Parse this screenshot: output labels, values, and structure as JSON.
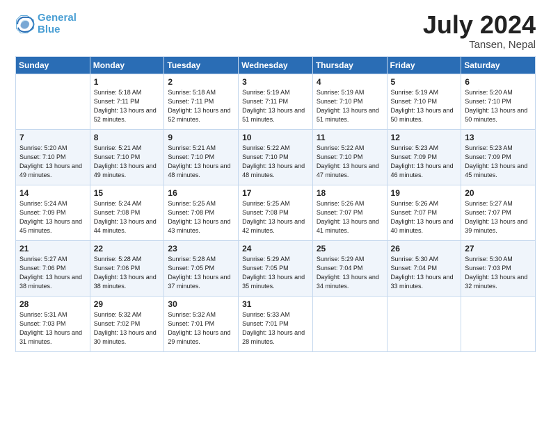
{
  "logo": {
    "line1": "General",
    "line2": "Blue"
  },
  "title": "July 2024",
  "location": "Tansen, Nepal",
  "weekdays": [
    "Sunday",
    "Monday",
    "Tuesday",
    "Wednesday",
    "Thursday",
    "Friday",
    "Saturday"
  ],
  "weeks": [
    [
      {
        "day": "",
        "info": ""
      },
      {
        "day": "1",
        "info": "Sunrise: 5:18 AM\nSunset: 7:11 PM\nDaylight: 13 hours\nand 52 minutes."
      },
      {
        "day": "2",
        "info": "Sunrise: 5:18 AM\nSunset: 7:11 PM\nDaylight: 13 hours\nand 52 minutes."
      },
      {
        "day": "3",
        "info": "Sunrise: 5:19 AM\nSunset: 7:11 PM\nDaylight: 13 hours\nand 51 minutes."
      },
      {
        "day": "4",
        "info": "Sunrise: 5:19 AM\nSunset: 7:10 PM\nDaylight: 13 hours\nand 51 minutes."
      },
      {
        "day": "5",
        "info": "Sunrise: 5:19 AM\nSunset: 7:10 PM\nDaylight: 13 hours\nand 50 minutes."
      },
      {
        "day": "6",
        "info": "Sunrise: 5:20 AM\nSunset: 7:10 PM\nDaylight: 13 hours\nand 50 minutes."
      }
    ],
    [
      {
        "day": "7",
        "info": "Sunrise: 5:20 AM\nSunset: 7:10 PM\nDaylight: 13 hours\nand 49 minutes."
      },
      {
        "day": "8",
        "info": "Sunrise: 5:21 AM\nSunset: 7:10 PM\nDaylight: 13 hours\nand 49 minutes."
      },
      {
        "day": "9",
        "info": "Sunrise: 5:21 AM\nSunset: 7:10 PM\nDaylight: 13 hours\nand 48 minutes."
      },
      {
        "day": "10",
        "info": "Sunrise: 5:22 AM\nSunset: 7:10 PM\nDaylight: 13 hours\nand 48 minutes."
      },
      {
        "day": "11",
        "info": "Sunrise: 5:22 AM\nSunset: 7:10 PM\nDaylight: 13 hours\nand 47 minutes."
      },
      {
        "day": "12",
        "info": "Sunrise: 5:23 AM\nSunset: 7:09 PM\nDaylight: 13 hours\nand 46 minutes."
      },
      {
        "day": "13",
        "info": "Sunrise: 5:23 AM\nSunset: 7:09 PM\nDaylight: 13 hours\nand 45 minutes."
      }
    ],
    [
      {
        "day": "14",
        "info": "Sunrise: 5:24 AM\nSunset: 7:09 PM\nDaylight: 13 hours\nand 45 minutes."
      },
      {
        "day": "15",
        "info": "Sunrise: 5:24 AM\nSunset: 7:08 PM\nDaylight: 13 hours\nand 44 minutes."
      },
      {
        "day": "16",
        "info": "Sunrise: 5:25 AM\nSunset: 7:08 PM\nDaylight: 13 hours\nand 43 minutes."
      },
      {
        "day": "17",
        "info": "Sunrise: 5:25 AM\nSunset: 7:08 PM\nDaylight: 13 hours\nand 42 minutes."
      },
      {
        "day": "18",
        "info": "Sunrise: 5:26 AM\nSunset: 7:07 PM\nDaylight: 13 hours\nand 41 minutes."
      },
      {
        "day": "19",
        "info": "Sunrise: 5:26 AM\nSunset: 7:07 PM\nDaylight: 13 hours\nand 40 minutes."
      },
      {
        "day": "20",
        "info": "Sunrise: 5:27 AM\nSunset: 7:07 PM\nDaylight: 13 hours\nand 39 minutes."
      }
    ],
    [
      {
        "day": "21",
        "info": "Sunrise: 5:27 AM\nSunset: 7:06 PM\nDaylight: 13 hours\nand 38 minutes."
      },
      {
        "day": "22",
        "info": "Sunrise: 5:28 AM\nSunset: 7:06 PM\nDaylight: 13 hours\nand 38 minutes."
      },
      {
        "day": "23",
        "info": "Sunrise: 5:28 AM\nSunset: 7:05 PM\nDaylight: 13 hours\nand 37 minutes."
      },
      {
        "day": "24",
        "info": "Sunrise: 5:29 AM\nSunset: 7:05 PM\nDaylight: 13 hours\nand 35 minutes."
      },
      {
        "day": "25",
        "info": "Sunrise: 5:29 AM\nSunset: 7:04 PM\nDaylight: 13 hours\nand 34 minutes."
      },
      {
        "day": "26",
        "info": "Sunrise: 5:30 AM\nSunset: 7:04 PM\nDaylight: 13 hours\nand 33 minutes."
      },
      {
        "day": "27",
        "info": "Sunrise: 5:30 AM\nSunset: 7:03 PM\nDaylight: 13 hours\nand 32 minutes."
      }
    ],
    [
      {
        "day": "28",
        "info": "Sunrise: 5:31 AM\nSunset: 7:03 PM\nDaylight: 13 hours\nand 31 minutes."
      },
      {
        "day": "29",
        "info": "Sunrise: 5:32 AM\nSunset: 7:02 PM\nDaylight: 13 hours\nand 30 minutes."
      },
      {
        "day": "30",
        "info": "Sunrise: 5:32 AM\nSunset: 7:01 PM\nDaylight: 13 hours\nand 29 minutes."
      },
      {
        "day": "31",
        "info": "Sunrise: 5:33 AM\nSunset: 7:01 PM\nDaylight: 13 hours\nand 28 minutes."
      },
      {
        "day": "",
        "info": ""
      },
      {
        "day": "",
        "info": ""
      },
      {
        "day": "",
        "info": ""
      }
    ]
  ]
}
